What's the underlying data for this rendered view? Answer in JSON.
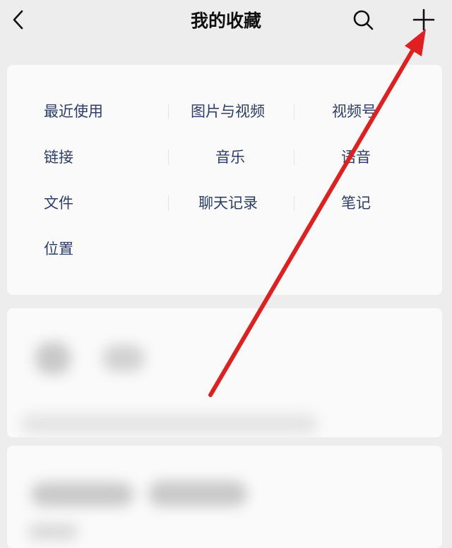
{
  "header": {
    "title": "我的收藏",
    "back_icon": "chevron-left-icon",
    "search_icon": "search-icon",
    "add_icon": "plus-icon"
  },
  "categories": {
    "items": [
      {
        "label": "最近使用"
      },
      {
        "label": "图片与视频"
      },
      {
        "label": "视频号"
      },
      {
        "label": "链接"
      },
      {
        "label": "音乐"
      },
      {
        "label": "语音"
      },
      {
        "label": "文件"
      },
      {
        "label": "聊天记录"
      },
      {
        "label": "笔记"
      },
      {
        "label": "位置"
      }
    ]
  },
  "colors": {
    "background": "#ededed",
    "card": "#fafafa",
    "category_text": "#2c3e66",
    "annotation_arrow": "#e02020"
  }
}
